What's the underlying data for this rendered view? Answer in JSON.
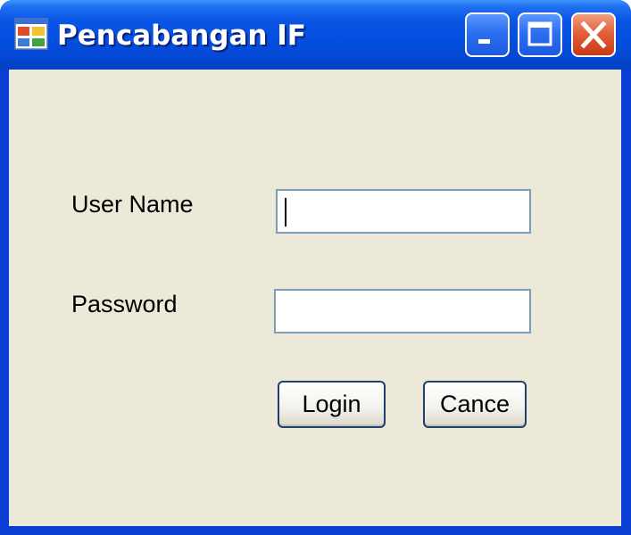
{
  "window": {
    "title": "Pencabangan IF",
    "icon": "windows-form-icon",
    "controls": {
      "minimize_icon": "minimize-icon",
      "maximize_icon": "maximize-icon",
      "close_icon": "close-icon"
    }
  },
  "form": {
    "username_label": "User Name",
    "username_value": "",
    "password_label": "Password",
    "password_value": "",
    "login_label": "Login",
    "cancel_label": "Cance"
  },
  "colors": {
    "titlebar": "#0450e0",
    "client_background": "#ece9d8",
    "close_button": "#e2613a",
    "input_border": "#7f9db9"
  }
}
